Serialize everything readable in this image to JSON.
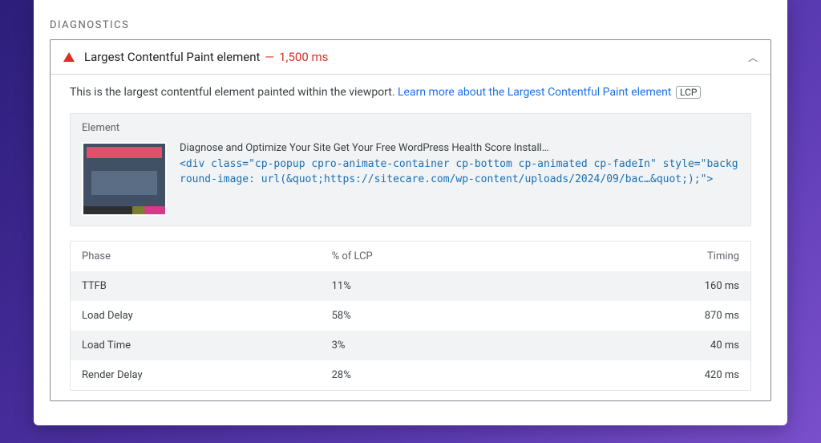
{
  "section": {
    "heading": "DIAGNOSTICS"
  },
  "diagnostic": {
    "title": "Largest Contentful Paint element",
    "separator": "—",
    "metric": "1,500 ms",
    "chevron": "︿"
  },
  "intro": {
    "text_before": "This is the largest contentful element painted within the viewport. ",
    "link_text": "Learn more about the Largest Contentful Paint element",
    "badge": "LCP"
  },
  "element_panel": {
    "header": "Element",
    "description": "Diagnose and Optimize Your Site  Get Your Free WordPress Health Score Install…",
    "code": "<div class=\"cp-popup cpro-animate-container cp-bottom cp-animated cp-fadeIn\" style=\"background-image: url(&quot;https://sitecare.com/wp-content/uploads/2024/09/bac…&quot;);\">"
  },
  "phases": {
    "headers": {
      "phase": "Phase",
      "pct": "% of LCP",
      "timing": "Timing"
    },
    "rows": [
      {
        "phase": "TTFB",
        "pct": "11%",
        "timing": "160 ms"
      },
      {
        "phase": "Load Delay",
        "pct": "58%",
        "timing": "870 ms"
      },
      {
        "phase": "Load Time",
        "pct": "3%",
        "timing": "40 ms"
      },
      {
        "phase": "Render Delay",
        "pct": "28%",
        "timing": "420 ms"
      }
    ]
  }
}
